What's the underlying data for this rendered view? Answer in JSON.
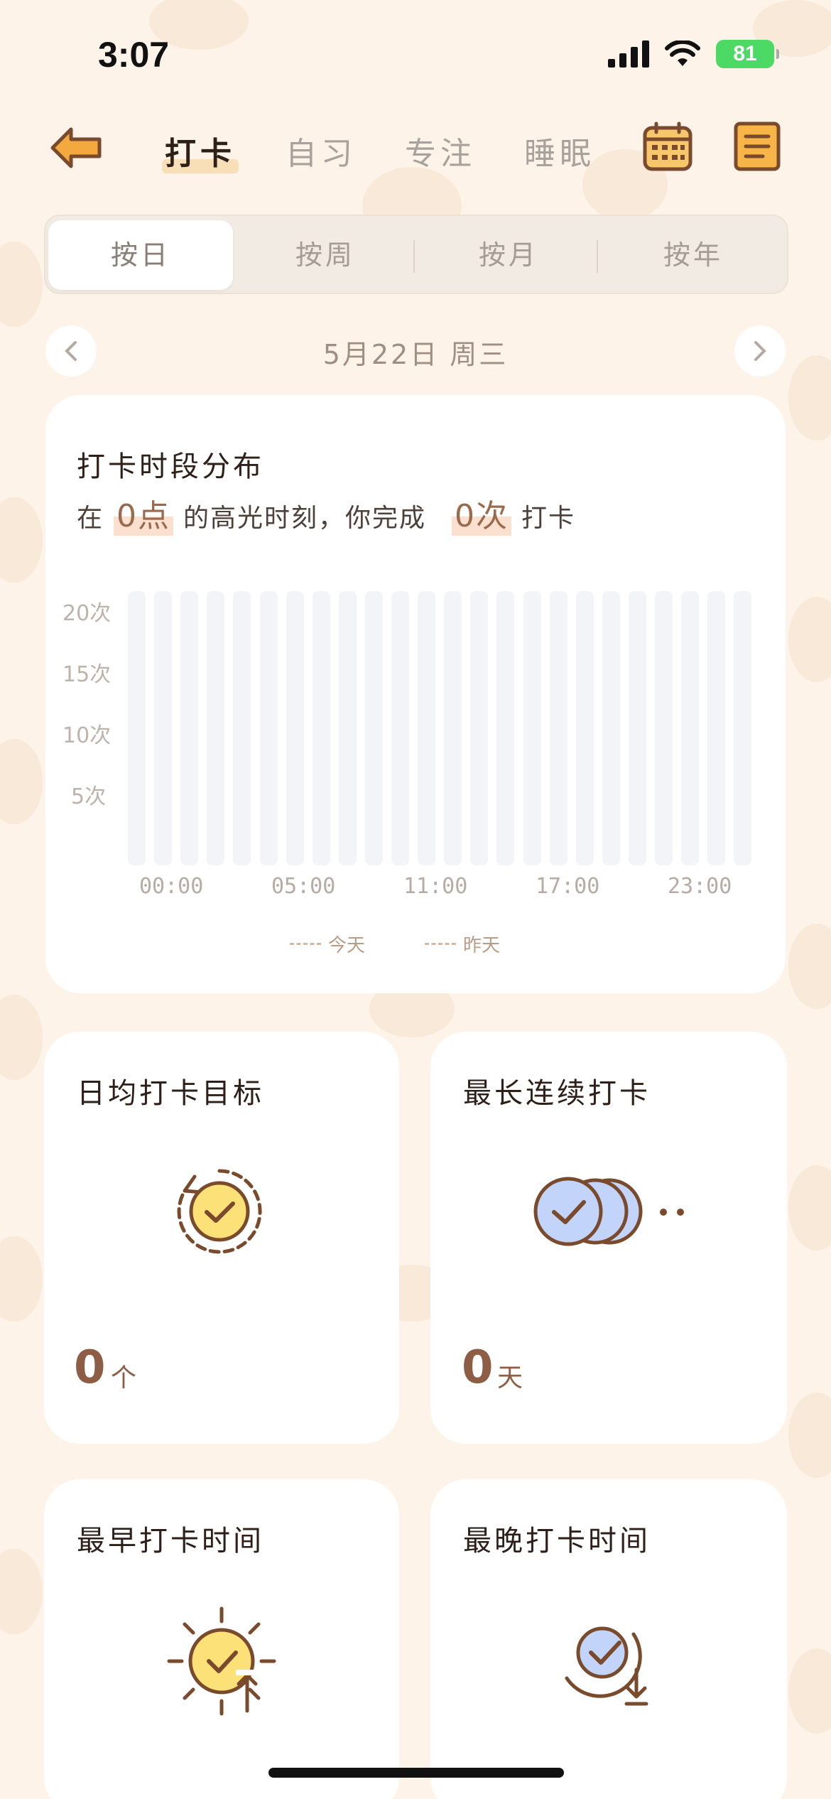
{
  "status": {
    "time": "3:07",
    "battery": "81"
  },
  "header": {
    "tabs": [
      {
        "label": "打卡",
        "active": true
      },
      {
        "label": "自习",
        "active": false
      },
      {
        "label": "专注",
        "active": false
      },
      {
        "label": "睡眠",
        "active": false
      }
    ]
  },
  "segment": {
    "items": [
      "按日",
      "按周",
      "按月",
      "按年"
    ],
    "selected": "按日"
  },
  "date_nav": {
    "label": "5月22日  周三"
  },
  "distribution": {
    "title": "打卡时段分布",
    "sentence": {
      "pre": "在",
      "hour": "0点",
      "mid": "的高光时刻，你完成",
      "count": "0次",
      "post": "打卡"
    },
    "chart_data": {
      "type": "bar",
      "y_ticks": [
        "20次",
        "15次",
        "10次",
        "5次"
      ],
      "x_ticks": [
        "00:00",
        "05:00",
        "11:00",
        "17:00",
        "23:00"
      ],
      "ylim": [
        0,
        20
      ],
      "series": [
        {
          "name": "今天",
          "values": [
            0,
            0,
            0,
            0,
            0,
            0,
            0,
            0,
            0,
            0,
            0,
            0,
            0,
            0,
            0,
            0,
            0,
            0,
            0,
            0,
            0,
            0,
            0,
            0
          ]
        },
        {
          "name": "昨天",
          "values": [
            0,
            0,
            0,
            0,
            0,
            0,
            0,
            0,
            0,
            0,
            0,
            0,
            0,
            0,
            0,
            0,
            0,
            0,
            0,
            0,
            0,
            0,
            0,
            0
          ]
        }
      ],
      "legend": [
        "今天",
        "昨天"
      ]
    }
  },
  "daily_goal": {
    "title": "日均打卡目标",
    "value": "0",
    "unit": "个"
  },
  "longest_streak": {
    "title": "最长连续打卡",
    "value": "0",
    "unit": "天"
  },
  "earliest": {
    "title": "最早打卡时间"
  },
  "latest": {
    "title": "最晚打卡时间"
  }
}
